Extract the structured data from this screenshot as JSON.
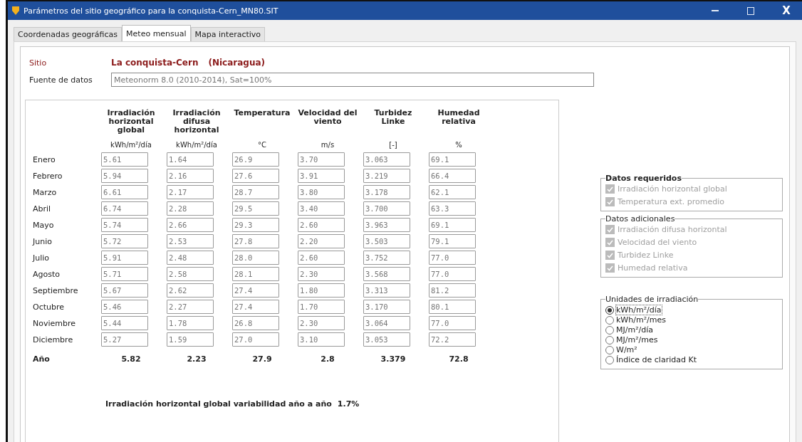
{
  "window": {
    "title": "Parámetros del sitio geográfico para la conquista-Cern_MN80.SIT",
    "close_label": "X"
  },
  "tabs": [
    {
      "label": "Coordenadas geográficas",
      "selected": false
    },
    {
      "label": "Meteo mensual",
      "selected": true
    },
    {
      "label": "Mapa interactivo",
      "selected": false
    }
  ],
  "site": {
    "label": "Sitio",
    "name": "La conquista-Cern",
    "country": "(Nicaragua)"
  },
  "source": {
    "label": "Fuente de datos",
    "value": "Meteonorm 8.0 (2010-2014), Sat=100%"
  },
  "table": {
    "columns": [
      {
        "header": "Irradiación horizontal global",
        "unit": "kWh/m²/día"
      },
      {
        "header": "Irradiación difusa horizontal",
        "unit": "kWh/m²/día"
      },
      {
        "header": "Temperatura",
        "unit": "°C"
      },
      {
        "header": "Velocidad del viento",
        "unit": "m/s"
      },
      {
        "header": "Turbidez Linke",
        "unit": "[-]"
      },
      {
        "header": "Humedad relativa",
        "unit": "%"
      }
    ],
    "rows": [
      {
        "month": "Enero",
        "values": [
          "5.61",
          "1.64",
          "26.9",
          "3.70",
          "3.063",
          "69.1"
        ]
      },
      {
        "month": "Febrero",
        "values": [
          "5.94",
          "2.16",
          "27.6",
          "3.91",
          "3.219",
          "66.4"
        ]
      },
      {
        "month": "Marzo",
        "values": [
          "6.61",
          "2.17",
          "28.7",
          "3.80",
          "3.178",
          "62.1"
        ]
      },
      {
        "month": "Abril",
        "values": [
          "6.74",
          "2.28",
          "29.5",
          "3.40",
          "3.700",
          "63.3"
        ]
      },
      {
        "month": "Mayo",
        "values": [
          "5.74",
          "2.66",
          "29.3",
          "2.60",
          "3.963",
          "69.1"
        ]
      },
      {
        "month": "Junio",
        "values": [
          "5.72",
          "2.53",
          "27.8",
          "2.20",
          "3.503",
          "79.1"
        ]
      },
      {
        "month": "Julio",
        "values": [
          "5.91",
          "2.48",
          "28.0",
          "2.60",
          "3.752",
          "77.0"
        ]
      },
      {
        "month": "Agosto",
        "values": [
          "5.71",
          "2.58",
          "28.1",
          "2.30",
          "3.568",
          "77.0"
        ]
      },
      {
        "month": "Septiembre",
        "values": [
          "5.67",
          "2.62",
          "27.4",
          "1.80",
          "3.313",
          "81.2"
        ]
      },
      {
        "month": "Octubre",
        "values": [
          "5.46",
          "2.27",
          "27.4",
          "1.70",
          "3.170",
          "80.1"
        ]
      },
      {
        "month": "Noviembre",
        "values": [
          "5.44",
          "1.78",
          "26.8",
          "2.30",
          "3.064",
          "77.0"
        ]
      },
      {
        "month": "Diciembre",
        "values": [
          "5.27",
          "1.59",
          "27.0",
          "3.10",
          "3.053",
          "72.2"
        ]
      }
    ],
    "total": {
      "label": "Año",
      "values": [
        "5.82",
        "2.23",
        "27.9",
        "2.8",
        "3.379",
        "72.8"
      ]
    }
  },
  "variability": {
    "label": "Irradiación horizontal global variabilidad año a año",
    "value": "1.7%"
  },
  "required": {
    "title": "Datos requeridos",
    "items": [
      {
        "label": "Irradiación horizontal global",
        "checked": true,
        "disabled": true
      },
      {
        "label": "Temperatura ext. promedio",
        "checked": true,
        "disabled": true
      }
    ]
  },
  "additional": {
    "title": "Datos adicionales",
    "items": [
      {
        "label": "Irradiación difusa horizontal",
        "checked": true,
        "disabled": true
      },
      {
        "label": "Velocidad del viento",
        "checked": true,
        "disabled": true
      },
      {
        "label": "Turbidez Linke",
        "checked": true,
        "disabled": true
      },
      {
        "label": "Humedad relativa",
        "checked": true,
        "disabled": true
      }
    ]
  },
  "units": {
    "title": "Unidades de irradiación",
    "options": [
      {
        "label": "kWh/m²/día",
        "selected": true
      },
      {
        "label": "kWh/m²/mes",
        "selected": false
      },
      {
        "label": "MJ/m²/día",
        "selected": false
      },
      {
        "label": "MJ/m²/mes",
        "selected": false
      },
      {
        "label": "W/m²",
        "selected": false
      },
      {
        "label": "Índice de claridad Kt",
        "selected": false
      }
    ]
  }
}
